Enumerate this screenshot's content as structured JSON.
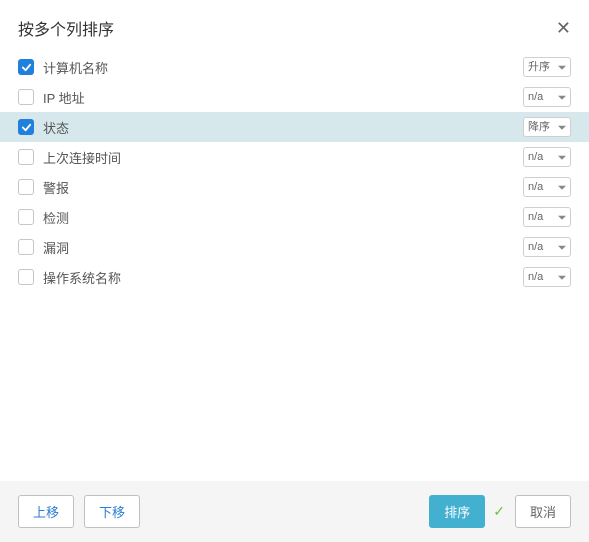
{
  "title": "按多个列排序",
  "rows": [
    {
      "label": "计算机名称",
      "checked": true,
      "order": "升序",
      "selected": false
    },
    {
      "label": "IP 地址",
      "checked": false,
      "order": "n/a",
      "selected": false
    },
    {
      "label": "状态",
      "checked": true,
      "order": "降序",
      "selected": true
    },
    {
      "label": "上次连接时间",
      "checked": false,
      "order": "n/a",
      "selected": false
    },
    {
      "label": "警报",
      "checked": false,
      "order": "n/a",
      "selected": false
    },
    {
      "label": "检测",
      "checked": false,
      "order": "n/a",
      "selected": false
    },
    {
      "label": "漏洞",
      "checked": false,
      "order": "n/a",
      "selected": false
    },
    {
      "label": "操作系统名称",
      "checked": false,
      "order": "n/a",
      "selected": false
    }
  ],
  "footer": {
    "move_up": "上移",
    "move_down": "下移",
    "sort": "排序",
    "cancel": "取消"
  }
}
